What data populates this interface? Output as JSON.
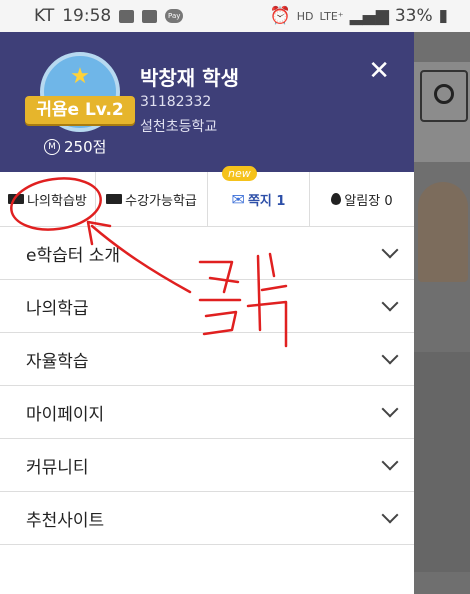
{
  "status": {
    "carrier": "KT",
    "time": "19:58",
    "network": "LTE⁺",
    "battery": "33%",
    "hd": "HD",
    "pay": "Pay"
  },
  "profile": {
    "level": "귀욤e Lv.2",
    "points": "250점",
    "point_symbol": "M",
    "name": "박창재 학생",
    "id": "31182332",
    "school": "설천초등학교"
  },
  "tabs": [
    {
      "label": "나의학습방"
    },
    {
      "label": "수강가능학급"
    },
    {
      "label": "쪽지 1",
      "tag": "new"
    },
    {
      "label": "알림장 0"
    }
  ],
  "menu": [
    {
      "label": "e학습터 소개"
    },
    {
      "label": "나의학급"
    },
    {
      "label": "자율학습"
    },
    {
      "label": "마이페이지"
    },
    {
      "label": "커뮤니티"
    },
    {
      "label": "추천사이트"
    }
  ],
  "annotation": {
    "text": "클릭",
    "color": "#e02020"
  },
  "colors": {
    "header": "#3e3f78",
    "badge": "#e6b52c",
    "accent": "#2d4fa8"
  }
}
